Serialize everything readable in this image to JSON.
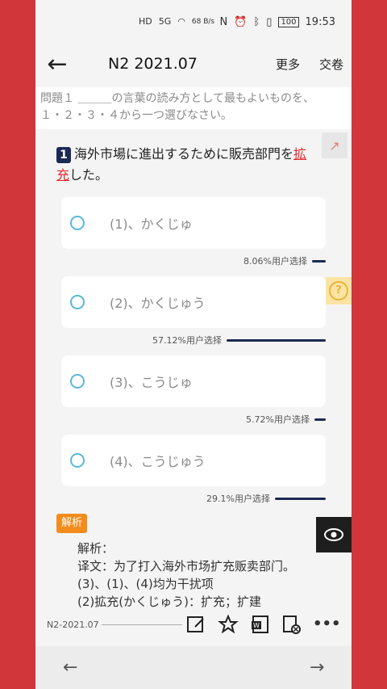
{
  "status": {
    "net": "HD",
    "signal": "5G",
    "speed": "68 B/s",
    "battery": "100",
    "time": "19:53"
  },
  "header": {
    "title": "N2 2021.07",
    "more": "更多",
    "submit": "交卷"
  },
  "instruction": {
    "line1": "問題１ ＿＿＿の言葉の読み方として最もよいものを、",
    "line2": "１・２・３・４から一つ選びなさい。"
  },
  "question": {
    "number": "1",
    "text_before": "海外市場に進出するために販売部門を",
    "underlined_1": "拡",
    "underlined_2": "充",
    "text_after": "した。"
  },
  "options": [
    {
      "label": "(1)、かくじゅ",
      "stat": "8.06%用户选择",
      "pct": 8.06
    },
    {
      "label": "(2)、かくじゅう",
      "stat": "57.12%用户选择",
      "pct": 57.12
    },
    {
      "label": "(3)、こうじゅ",
      "stat": "5.72%用户选择",
      "pct": 5.72
    },
    {
      "label": "(4)、こうじゅう",
      "stat": "29.1%用户选择",
      "pct": 29.1
    }
  ],
  "analysis": {
    "tag": "解析",
    "heading": "解析：",
    "line1": "译文：为了打入海外市场扩充贩卖部门。",
    "line2": "(3)、(1)、(4)均为干扰项",
    "line3": "(2)拡充(かくじゅう)：扩充；扩建"
  },
  "footer": {
    "label": "N2-2021.07"
  },
  "nav": {
    "back": "←",
    "forward": "→"
  },
  "icons": {
    "back": "back-arrow-icon",
    "share": "share-icon",
    "help": "help-icon",
    "eye": "eye-icon",
    "edit": "edit-note-icon",
    "star": "star-icon",
    "word": "word-export-icon",
    "delete": "delete-note-icon",
    "more": "more-dots-icon"
  },
  "colors": {
    "accent_navy": "#1b2a52",
    "radio": "#59b8d8",
    "analysis_tag": "#f28c1c",
    "highlight_red": "#e0292b"
  }
}
